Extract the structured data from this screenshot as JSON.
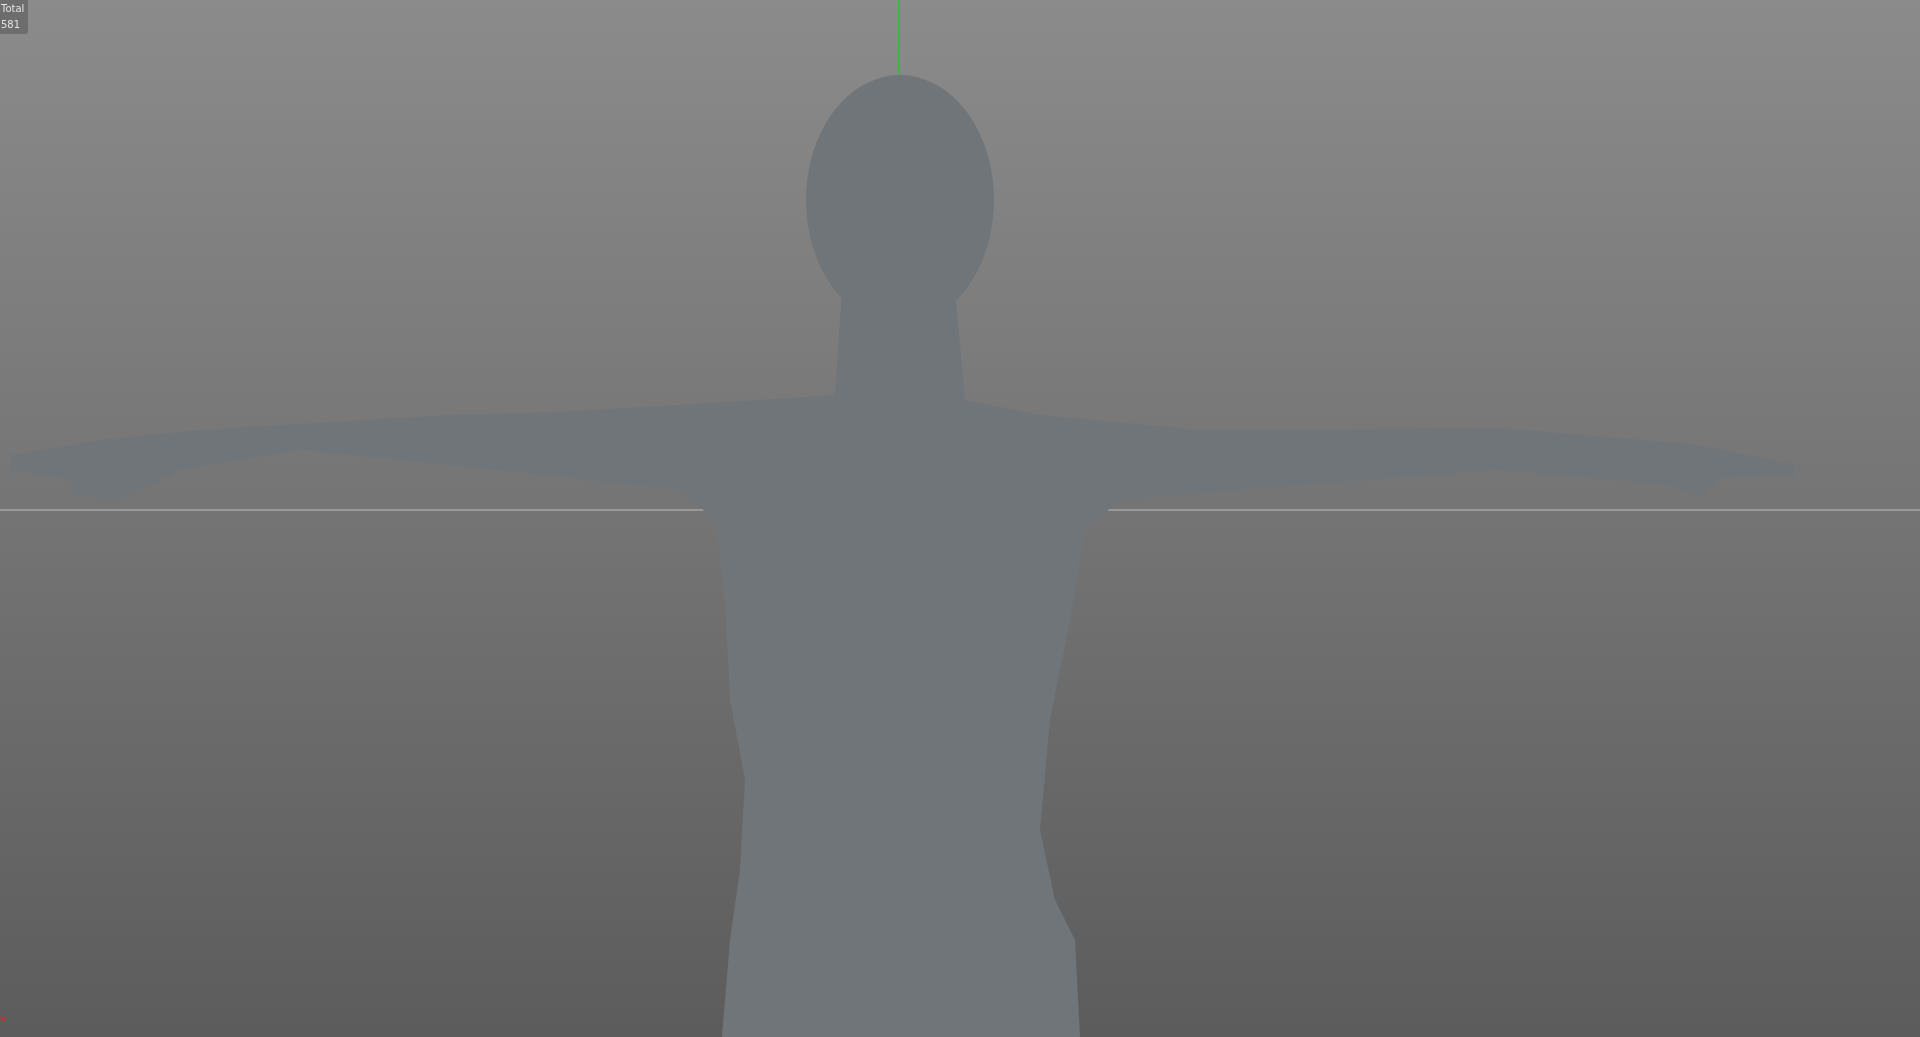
{
  "viewport": {
    "stats": {
      "label": "Total",
      "value": "581"
    }
  }
}
